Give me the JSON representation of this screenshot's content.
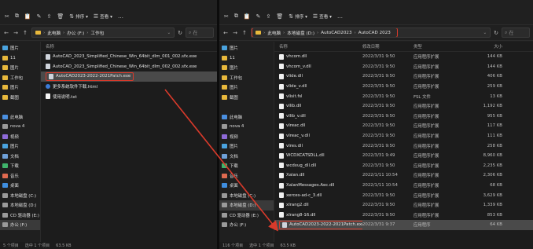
{
  "toolbar_left": [
    {
      "icon": "cut-icon",
      "glyph": "✂",
      "label": ""
    },
    {
      "icon": "copy-icon",
      "glyph": "⧉",
      "label": ""
    },
    {
      "icon": "paste-icon",
      "glyph": "📋",
      "label": ""
    },
    {
      "icon": "rename-icon",
      "glyph": "✎",
      "label": ""
    },
    {
      "icon": "share-icon",
      "glyph": "⇪",
      "label": ""
    },
    {
      "icon": "delete-icon",
      "glyph": "🗑",
      "label": ""
    },
    {
      "icon": "sort-icon",
      "glyph": "⇅",
      "label": "排序 ▾"
    },
    {
      "icon": "view-icon",
      "glyph": "☰",
      "label": "查看 ▾"
    },
    {
      "icon": "more-icon",
      "glyph": "…",
      "label": ""
    }
  ],
  "toolbar_right": [
    {
      "icon": "cut-icon",
      "glyph": "✂",
      "label": ""
    },
    {
      "icon": "copy-icon",
      "glyph": "⧉",
      "label": ""
    },
    {
      "icon": "paste-icon",
      "glyph": "📋",
      "label": ""
    },
    {
      "icon": "rename-icon",
      "glyph": "✎",
      "label": ""
    },
    {
      "icon": "share-icon",
      "glyph": "⇪",
      "label": ""
    },
    {
      "icon": "delete-icon",
      "glyph": "🗑",
      "label": ""
    },
    {
      "icon": "sort-icon",
      "glyph": "⇅",
      "label": "排序 ▾"
    },
    {
      "icon": "view-icon",
      "glyph": "☰",
      "label": "查看 ▾"
    },
    {
      "icon": "more-icon",
      "glyph": "…",
      "label": ""
    }
  ],
  "left": {
    "breadcrumb": [
      "此电脑",
      "办公 (F:)",
      "工作包"
    ],
    "search_placeholder": "在",
    "col_name": "名称",
    "sidebar": [
      {
        "label": "图片",
        "color": "#4aa3df"
      },
      {
        "label": "11",
        "color": "#e8b83c"
      },
      {
        "label": "图片",
        "color": "#e8b83c"
      },
      {
        "label": "工作包",
        "color": "#e8b83c"
      },
      {
        "label": "图片",
        "color": "#e8b83c"
      },
      {
        "label": "截图",
        "color": "#e8b83c"
      },
      {
        "label": "",
        "color": "#1f1f1f"
      },
      {
        "label": "此电脑",
        "color": "#4a8fe0"
      },
      {
        "label": "nova 4",
        "color": "#9a9a9a"
      },
      {
        "label": "视频",
        "color": "#8e6ad8"
      },
      {
        "label": "图片",
        "color": "#4aa3df"
      },
      {
        "label": "文档",
        "color": "#6fa0d8"
      },
      {
        "label": "下载",
        "color": "#3fb36b"
      },
      {
        "label": "音乐",
        "color": "#e06a50"
      },
      {
        "label": "桌面",
        "color": "#3f8ee0"
      },
      {
        "label": "本地磁盘 (C:)",
        "color": "#9a9a9a"
      },
      {
        "label": "本地磁盘 (D:)",
        "color": "#9a9a9a"
      },
      {
        "label": "CD 驱动器 (E:)",
        "color": "#9a9a9a"
      },
      {
        "label": "办公 (F:)",
        "color": "#9a9a9a"
      }
    ],
    "files": [
      {
        "name": "AutoCAD_2023_Simplified_Chinese_Win_64bit_dlm_001_002.sfx.exe",
        "kind": "exe"
      },
      {
        "name": "AutoCAD_2023_Simplified_Chinese_Win_64bit_dlm_002_002.sfx.exe",
        "kind": "exe"
      },
      {
        "name": "AutoCAD2023-2022-2021Patch.exe",
        "kind": "exe"
      },
      {
        "name": "更多系统软件下载.html",
        "kind": "html"
      },
      {
        "name": "使用说明.txt",
        "kind": "txt"
      }
    ],
    "status": [
      "5 个项目",
      "选中 1 个项目",
      "63.5 KB"
    ]
  },
  "right": {
    "breadcrumb": [
      "此电脑",
      "本地磁盘 (D:)",
      "AutoCAD2023",
      "AutoCAD 2023"
    ],
    "search_placeholder": "在",
    "columns": {
      "name": "名称",
      "date": "修改日期",
      "type": "类型",
      "size": "大小"
    },
    "sidebar": [
      {
        "label": "图片",
        "color": "#4aa3df"
      },
      {
        "label": "11",
        "color": "#e8b83c"
      },
      {
        "label": "图片",
        "color": "#e8b83c"
      },
      {
        "label": "工作包",
        "color": "#e8b83c"
      },
      {
        "label": "图片",
        "color": "#e8b83c"
      },
      {
        "label": "截图",
        "color": "#e8b83c"
      },
      {
        "label": "",
        "color": "#1f1f1f"
      },
      {
        "label": "此电脑",
        "color": "#4a8fe0"
      },
      {
        "label": "nova 4",
        "color": "#9a9a9a"
      },
      {
        "label": "视频",
        "color": "#8e6ad8"
      },
      {
        "label": "图片",
        "color": "#4aa3df"
      },
      {
        "label": "文档",
        "color": "#6fa0d8"
      },
      {
        "label": "下载",
        "color": "#3fb36b"
      },
      {
        "label": "音乐",
        "color": "#e06a50"
      },
      {
        "label": "桌面",
        "color": "#3f8ee0"
      },
      {
        "label": "本地磁盘 (C:)",
        "color": "#9a9a9a"
      },
      {
        "label": "本地磁盘 (D:)",
        "color": "#9a9a9a"
      },
      {
        "label": "CD 驱动器 (E:)",
        "color": "#9a9a9a"
      },
      {
        "label": "办公 (F:)",
        "color": "#9a9a9a"
      }
    ],
    "files": [
      {
        "name": "vhcom.dll",
        "date": "2022/3/31 9:50",
        "type": "应用程序扩展",
        "size": "144 KB",
        "kind": "dll"
      },
      {
        "name": "vhcom_v.dll",
        "date": "2022/3/31 9:50",
        "type": "应用程序扩展",
        "size": "144 KB",
        "kind": "dll"
      },
      {
        "name": "vlide.dll",
        "date": "2022/3/31 9:50",
        "type": "应用程序扩展",
        "size": "406 KB",
        "kind": "dll"
      },
      {
        "name": "vlide_v.dll",
        "date": "2022/3/31 9:50",
        "type": "应用程序扩展",
        "size": "259 KB",
        "kind": "dll"
      },
      {
        "name": "vlisit.fsl",
        "date": "2022/3/31 9:50",
        "type": "FSL 文件",
        "size": "13 KB",
        "kind": "fsl"
      },
      {
        "name": "vllib.dll",
        "date": "2022/3/31 9:50",
        "type": "应用程序扩展",
        "size": "1,192 KB",
        "kind": "dll"
      },
      {
        "name": "vllib_v.dll",
        "date": "2022/3/31 9:50",
        "type": "应用程序扩展",
        "size": "955 KB",
        "kind": "dll"
      },
      {
        "name": "vlreac.dll",
        "date": "2022/3/31 9:50",
        "type": "应用程序扩展",
        "size": "117 KB",
        "kind": "dll"
      },
      {
        "name": "vlreac_v.dll",
        "date": "2022/3/31 9:50",
        "type": "应用程序扩展",
        "size": "111 KB",
        "kind": "dll"
      },
      {
        "name": "vlres.dll",
        "date": "2022/3/31 9:50",
        "type": "应用程序扩展",
        "size": "258 KB",
        "kind": "dll"
      },
      {
        "name": "WCDXCATSDLL.dll",
        "date": "2022/3/31 9:49",
        "type": "应用程序扩展",
        "size": "8,960 KB",
        "kind": "dll"
      },
      {
        "name": "wcdxug_dll.dll",
        "date": "2022/3/31 9:50",
        "type": "应用程序扩展",
        "size": "2,235 KB",
        "kind": "dll"
      },
      {
        "name": "Xalan.dll",
        "date": "2022/1/11 10:54",
        "type": "应用程序扩展",
        "size": "2,306 KB",
        "kind": "dll"
      },
      {
        "name": "XalanMessages.Aec.dll",
        "date": "2022/1/11 10:54",
        "type": "应用程序扩展",
        "size": "68 KB",
        "kind": "dll"
      },
      {
        "name": "xerces-ad-c_3.dll",
        "date": "2022/3/31 9:50",
        "type": "应用程序扩展",
        "size": "3,629 KB",
        "kind": "dll"
      },
      {
        "name": "xlrang2.dll",
        "date": "2022/3/31 9:50",
        "type": "应用程序扩展",
        "size": "1,339 KB",
        "kind": "dll"
      },
      {
        "name": "xlrang8-16.dll",
        "date": "2022/3/31 9:50",
        "type": "应用程序扩展",
        "size": "853 KB",
        "kind": "dll"
      },
      {
        "name": "AutoCAD2023-2022-2021Patch.exe",
        "date": "2022/3/31 9:37",
        "type": "应用程序",
        "size": "64 KB",
        "kind": "exe"
      }
    ],
    "status": [
      "116 个项目",
      "选中 1 个项目",
      "63.5 KB"
    ]
  },
  "colors": {
    "highlight": "#d93a2b",
    "selection": "#4a4a4a",
    "folder": "#e8b83c"
  }
}
